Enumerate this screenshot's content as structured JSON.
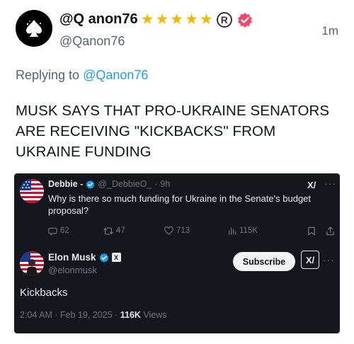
{
  "post": {
    "display_name": "@Q anon76",
    "stars": [
      "★",
      "★",
      "★",
      "★",
      "★"
    ],
    "registered_mark": "R",
    "handle": "@Qanon76",
    "time": "1m",
    "replying_prefix": "Replying to",
    "replying_handle": "@Qanon76",
    "text": "MUSK SAYS THAT PRO-UKRAINE SENATORS ARE RECEIVING \"KICKBACKS\" FROM UKRAINE FUNDING",
    "colors": {
      "star": "#f5b800",
      "verified_badge": "#f2476f",
      "link": "#1d9bf0"
    }
  },
  "embed": {
    "quoted": {
      "name": "Debbie -",
      "handle": "@_DebbieO_",
      "separator": "·",
      "time": "9h",
      "text": "Why is there so much funding for Ukraine in the Senate's budget proposal?",
      "grok_label": "X/",
      "more": "···",
      "metrics": {
        "replies": "62",
        "reposts": "47",
        "likes": "713",
        "views": "115K"
      }
    },
    "reply": {
      "name": "Elon Musk",
      "affiliate_badge": "X",
      "handle": "@elonmusk",
      "subscribe_label": "Subscribe",
      "grok_label": "X/",
      "more": "···",
      "text": "Kickbacks",
      "date": "2:04 AM · Feb 19, 2025 ·",
      "views_count": "116K",
      "views_label": "Views"
    },
    "colors": {
      "background": "#15171c",
      "verified": "#1d9bf0"
    }
  }
}
